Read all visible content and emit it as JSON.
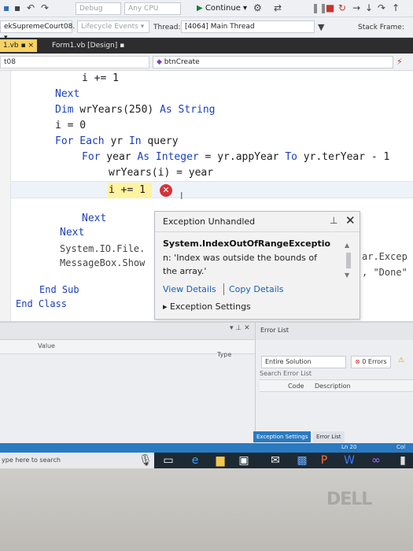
{
  "toolbar": {
    "config": "Debug",
    "platform": "Any CPU",
    "continue_label": "Continue",
    "colors": {
      "debug_green": "#1a7f37",
      "stop_red": "#c5352b"
    }
  },
  "debugbar": {
    "process": "ekSupremeCourt08.",
    "lifecycle": "Lifecycle Events",
    "thread_label": "Thread:",
    "thread_value": "[4064] Main Thread",
    "stack_frame": "Stack Frame:"
  },
  "tabs": [
    {
      "label": "1.vb"
    },
    {
      "label": "Form1.vb [Design]"
    }
  ],
  "navbar": {
    "left": "t08",
    "member": "btnCreate"
  },
  "code": {
    "line_i_increment_top": "i += 1",
    "next1": "Next",
    "dim_kw": "Dim",
    "dim_rest": " wrYears(250) ",
    "as_kw": "As",
    "string_kw": " String",
    "i_zero": "i = 0",
    "for_each_kw": "For Each",
    "yr": " yr ",
    "in_kw": "In",
    "query": " query",
    "for_kw": "For",
    "year": " year ",
    "as2_kw": "As",
    "integer_kw": " Integer",
    "assign_range": " = yr.appYear ",
    "to_kw": "To",
    "range_end": " yr.terYear - 1",
    "wryears_assign": "wrYears(i) = year",
    "i_increment_current": "i += 1",
    "next_inner": "Next",
    "next_outer": "Next",
    "file_call": "System.IO.File.",
    "msgbox_call": "MessageBox.Show",
    "end_sub": "End Sub",
    "end_class": "End Class",
    "right_partial_1": "ar.Excep",
    "right_partial_2": ", \"Done\""
  },
  "exception": {
    "title": "Exception Unhandled",
    "type": "System.IndexOutOfRangeExceptio",
    "message_prefix": "n: 'Index was outside the bounds of",
    "message_suffix": "the array.'",
    "view_details": "View Details",
    "copy_details": "Copy Details",
    "settings": "Exception Settings"
  },
  "locals": {
    "value_header": "Value",
    "type_header": "Type"
  },
  "errors": {
    "title": "Error List",
    "scope": "Entire Solution",
    "errors_count": "0 Errors",
    "search_placeholder": "Search Error List",
    "code_header": "Code",
    "desc_header": "Description",
    "tab_exc_settings": "Exception Settings",
    "tab_error_list": "Error List"
  },
  "status": {
    "line": "Ln 20",
    "col": "Col"
  },
  "taskbar": {
    "search_placeholder": "ype here to search"
  },
  "brand": "DELL"
}
